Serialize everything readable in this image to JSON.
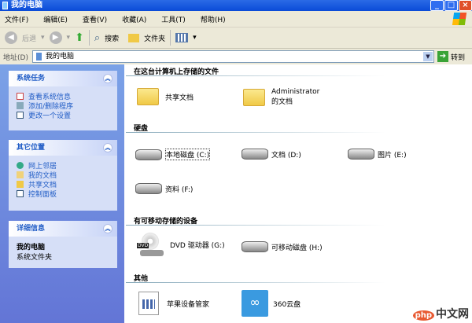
{
  "window": {
    "title": "我的电脑",
    "minimize": "_",
    "maximize": "□",
    "close": "×"
  },
  "menu": [
    "文件(F)",
    "编辑(E)",
    "查看(V)",
    "收藏(A)",
    "工具(T)",
    "帮助(H)"
  ],
  "toolbar": {
    "back": "后退",
    "search": "搜索",
    "folders": "文件夹"
  },
  "address": {
    "label": "地址(D)",
    "value": "我的电脑",
    "go": "转到"
  },
  "sidebar": {
    "system_tasks": {
      "title": "系统任务",
      "items": [
        "查看系统信息",
        "添加/删除程序",
        "更改一个设置"
      ]
    },
    "other_places": {
      "title": "其它位置",
      "items": [
        "网上邻居",
        "我的文档",
        "共享文档",
        "控制面板"
      ]
    },
    "details": {
      "title": "详细信息",
      "name": "我的电脑",
      "type": "系统文件夹"
    }
  },
  "content": {
    "stored_files": {
      "title": "在这台计算机上存储的文件",
      "items": [
        "共享文档",
        "Administrator 的文档"
      ]
    },
    "hard_disks": {
      "title": "硬盘",
      "items": [
        "本地磁盘 (C:)",
        "文档 (D:)",
        "图片 (E:)",
        "资料 (F:)"
      ]
    },
    "removable": {
      "title": "有可移动存储的设备",
      "items": [
        "DVD 驱动器 (G:)",
        "可移动磁盘 (H:)"
      ]
    },
    "other": {
      "title": "其他",
      "items": [
        "苹果设备管家",
        "360云盘"
      ]
    }
  },
  "watermark": {
    "logo": "php",
    "text": "中文网"
  }
}
